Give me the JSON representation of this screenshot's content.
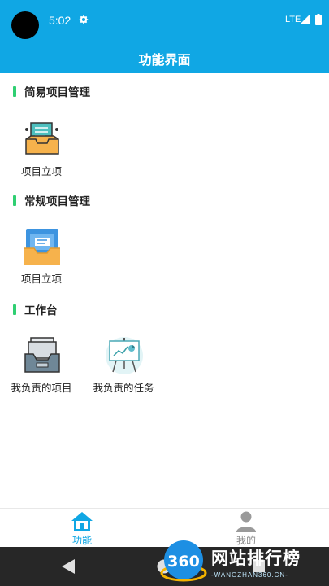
{
  "status_bar": {
    "time": "5:02",
    "network": "LTE"
  },
  "app_bar": {
    "title": "功能界面"
  },
  "sections": [
    {
      "title": "简易项目管理",
      "items": [
        {
          "label": "项目立项",
          "icon": "inbox-document-icon"
        }
      ]
    },
    {
      "title": "常规项目管理",
      "items": [
        {
          "label": "项目立项",
          "icon": "mail-tray-icon"
        }
      ]
    },
    {
      "title": "工作台",
      "items": [
        {
          "label": "我负责的项目",
          "icon": "file-tray-icon"
        },
        {
          "label": "我负责的任务",
          "icon": "presentation-board-icon"
        }
      ]
    }
  ],
  "bottom_nav": {
    "tabs": [
      {
        "label": "功能",
        "icon": "home-icon",
        "active": true
      },
      {
        "label": "我的",
        "icon": "user-icon",
        "active": false
      }
    ]
  },
  "watermark": {
    "logo": "360",
    "text": "网站排行榜",
    "sub": "-WANGZHAN360.CN-"
  },
  "colors": {
    "primary": "#10a7e4",
    "accent_bar": "#2fcf72",
    "active_tab": "#10a7e4",
    "inactive_tab": "#8a8a8a"
  }
}
